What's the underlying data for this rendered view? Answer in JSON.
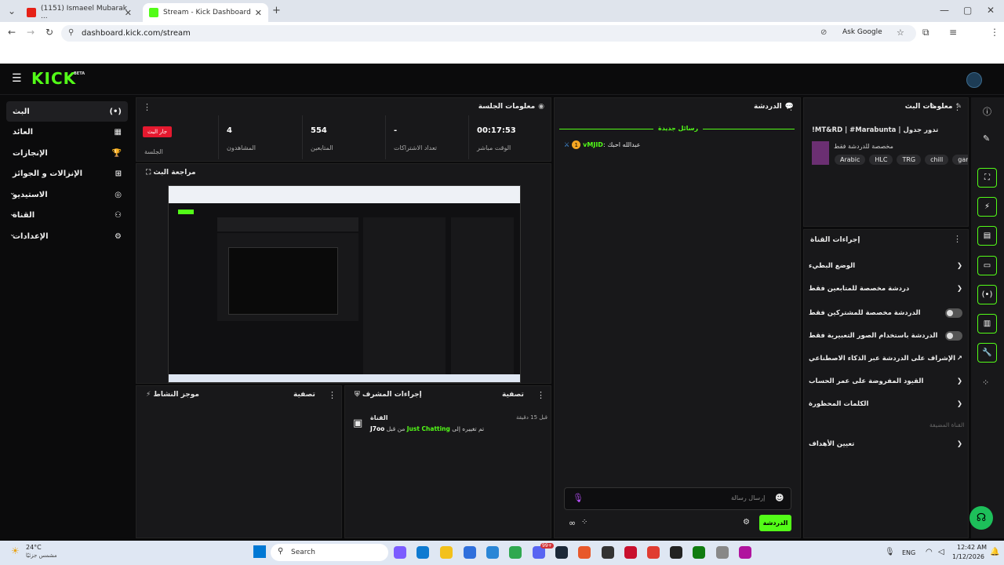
{
  "browser": {
    "tabs": [
      {
        "title": "(1151) Ismaeel Mubarak ...",
        "active": false
      },
      {
        "title": "Stream - Kick Dashboard",
        "active": true
      }
    ],
    "new_tab": "+",
    "url": "dashboard.kick.com/stream",
    "ask_google": "Ask Google",
    "min": "—",
    "max": "▢",
    "close": "✕"
  },
  "app": {
    "logo": "KICK",
    "beta": "BETA",
    "sidebar": [
      {
        "label": "البث",
        "icon": "(•)"
      },
      {
        "label": "العائد",
        "icon": "▦"
      },
      {
        "label": "الإنجازات",
        "icon": "🏆"
      },
      {
        "label": "الإنزالات و الجوائز",
        "icon": "⊞"
      },
      {
        "label": "الاستيديو",
        "icon": "◎"
      },
      {
        "label": "القناة",
        "icon": "⚇"
      },
      {
        "label": "الإعدادات",
        "icon": "⚙"
      }
    ],
    "session": {
      "title": "معلومات الجلسة",
      "stats": [
        {
          "value": "00:17:53",
          "label": "الوقت مباشر"
        },
        {
          "value": "-",
          "label": "تعداد الاشتراكات"
        },
        {
          "value": "554",
          "label": "المتابعين"
        },
        {
          "value": "4",
          "label": "المشاهدون"
        }
      ],
      "live_badge": "جار البث",
      "session_label": "الجلسة"
    },
    "preview": {
      "title": "مراجعة البث"
    },
    "activity": {
      "title": "موجز النشاط",
      "filter": "تصفية"
    },
    "mod": {
      "title": "إجراءات المشرف",
      "filter": "تصفية",
      "entry_title": "القناة",
      "time": "قبل 15 دقيقة",
      "who": "J7oo",
      "category": "Just Chatting",
      "text_before": "تم تغييره إلى",
      "text_mid": "من قبل"
    },
    "chat": {
      "title": "الدردشة",
      "new_messages": "رسائل جديدة",
      "msg_user": "vMJID",
      "msg_badge": "1",
      "msg_text": "عبدالله احبك",
      "input_placeholder": "إرسال رسالة",
      "send": "الدردشة"
    },
    "stream_info": {
      "title": "معلومات البث",
      "stream_title": "!MT&RD | #Marabunta | تدور جدول",
      "subtitle": "مخصصة للدردشة فقط",
      "tags": [
        "Arabic",
        "HLC",
        "TRG",
        "chill",
        "gami"
      ]
    },
    "channel_actions": {
      "title": "إجراءات القناة",
      "items": [
        "الوضع البطيء",
        "دردشة مخصصة للمتابعين فقط",
        "الدردشة مخصصة للمشتركين فقط",
        "الدردشة باستخدام الصور التعبيرية فقط",
        "الإشراف على الدردشة عبر الذكاء الاصطناعي",
        "القيود المفروضة على عمر الحساب",
        "الكلمات المحظورة"
      ],
      "disabled": "القناة المضيفة",
      "goals": "تعيين الأهداف"
    }
  },
  "taskbar": {
    "weather_temp": "24°C",
    "weather_desc": "مشمس جزئيًا",
    "search": "Search",
    "lang": "ENG",
    "time": "12:42 AM",
    "date": "1/12/2026",
    "badge": "99+"
  },
  "colors": {
    "kick_green": "#53fc18",
    "live_red": "#e5192f",
    "panel": "#18181a"
  }
}
